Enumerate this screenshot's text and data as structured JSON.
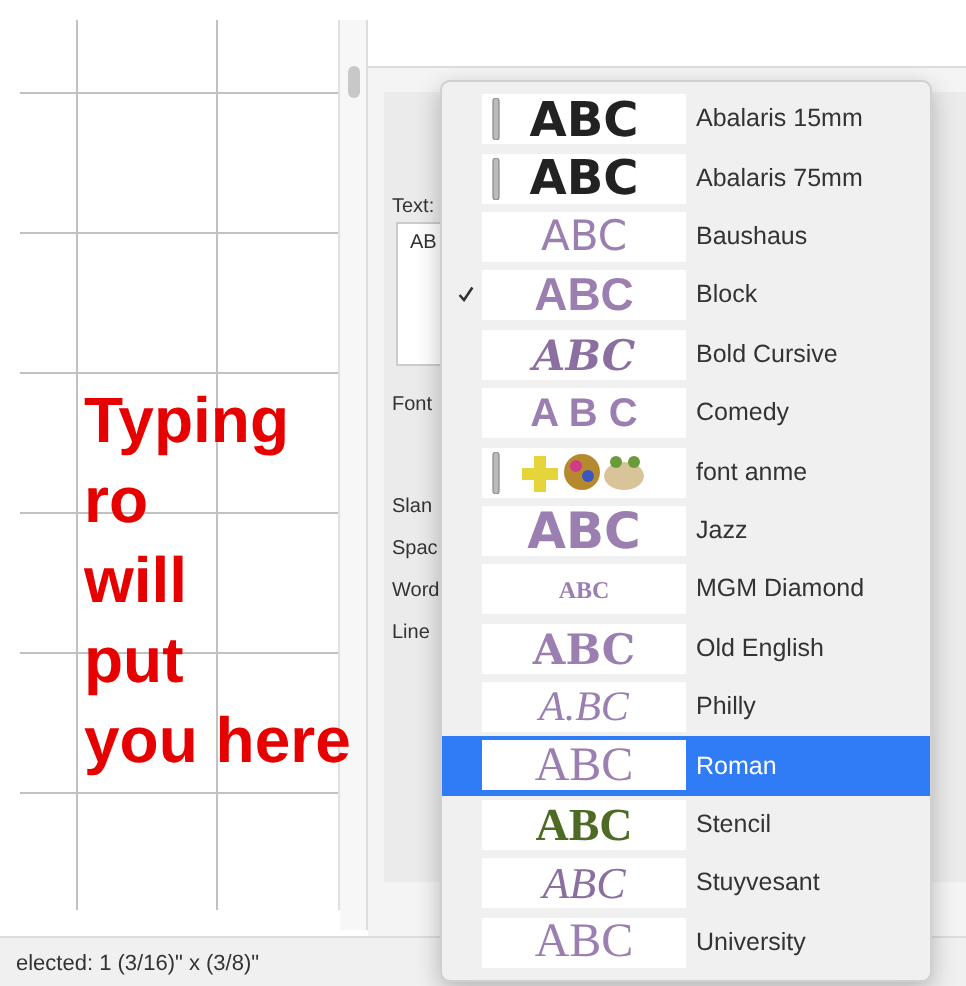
{
  "canvas": {
    "annotation": "Typing\nro\nwill\nput\nyou here"
  },
  "panel": {
    "text_label": "Text:",
    "text_value": "AB",
    "labels": [
      "Font",
      "Slan",
      "Spac",
      "Word",
      "Line"
    ]
  },
  "font_menu": {
    "items": [
      {
        "name": "Abalaris 15mm",
        "preview": "ABC",
        "kind": "heavy",
        "needle": true,
        "checked": false,
        "selected": false
      },
      {
        "name": "Abalaris 75mm",
        "preview": "ABC",
        "kind": "heavy",
        "needle": true,
        "checked": false,
        "selected": false
      },
      {
        "name": "Baushaus",
        "preview": "ABC",
        "kind": "thin",
        "needle": false,
        "checked": false,
        "selected": false
      },
      {
        "name": "Block",
        "preview": "ABC",
        "kind": "block",
        "needle": false,
        "checked": true,
        "selected": false
      },
      {
        "name": "Bold Cursive",
        "preview": "ABC",
        "kind": "script",
        "needle": false,
        "checked": false,
        "selected": false
      },
      {
        "name": "Comedy",
        "preview": "A B C",
        "kind": "comedy",
        "needle": false,
        "checked": false,
        "selected": false
      },
      {
        "name": "font anme",
        "kind": "picture",
        "needle": true,
        "checked": false,
        "selected": false
      },
      {
        "name": "Jazz",
        "preview": "ABC",
        "kind": "jazz",
        "needle": false,
        "checked": false,
        "selected": false
      },
      {
        "name": "MGM Diamond",
        "preview": "ABC",
        "kind": "monogram",
        "needle": false,
        "checked": false,
        "selected": false
      },
      {
        "name": "Old English",
        "preview": "ABC",
        "kind": "gothic",
        "needle": false,
        "checked": false,
        "selected": false
      },
      {
        "name": "Philly",
        "preview": "A.BC",
        "kind": "philly",
        "needle": false,
        "checked": false,
        "selected": false
      },
      {
        "name": "Roman",
        "preview": "ABC",
        "kind": "roman",
        "needle": false,
        "checked": false,
        "selected": true
      },
      {
        "name": "Stencil",
        "preview": "ABC",
        "kind": "stencil",
        "needle": false,
        "checked": false,
        "selected": false
      },
      {
        "name": "Stuyvesant",
        "preview": "ABC",
        "kind": "stuyvesant",
        "needle": false,
        "checked": false,
        "selected": false
      },
      {
        "name": "University",
        "preview": "ABC",
        "kind": "roman",
        "needle": false,
        "checked": false,
        "selected": false
      }
    ]
  },
  "status_bar": {
    "selection": "elected: 1 (3/16)\" x (3/8)\""
  }
}
